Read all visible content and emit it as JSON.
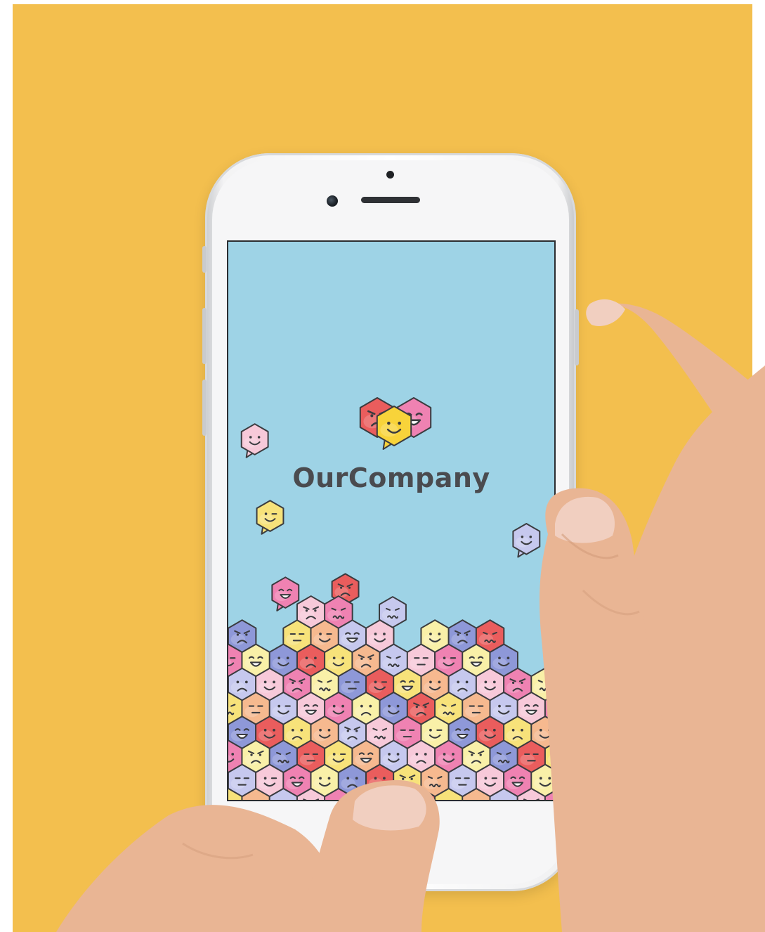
{
  "app": {
    "brand_name": "OurCompany",
    "logo_icon": "heart-of-speech-bubble-faces-logo"
  },
  "colors": {
    "backdrop": "#f3bf4e",
    "screen_background": "#9ed3e6",
    "phone_body": "#f6f6f7",
    "brand_text": "#4a4b4f",
    "emoji_yellow": "#f7e27a",
    "emoji_pink_light": "#f7c9d9",
    "emoji_pink": "#ef82b2",
    "emoji_red": "#ea5d5d",
    "emoji_peach": "#f6b98f",
    "emoji_lavender": "#c6c8ee",
    "emoji_blue": "#8e98d8",
    "emoji_cream": "#f9f0a8",
    "skin": "#e9b594"
  },
  "floating_emojis": [
    {
      "icon": "pink-smile-bubble-icon",
      "mood": "smile"
    },
    {
      "icon": "yellow-wink-bubble-icon",
      "mood": "wink"
    },
    {
      "icon": "pink-grin-bubble-icon",
      "mood": "grin"
    },
    {
      "icon": "red-angry-bubble-icon",
      "mood": "angry"
    },
    {
      "icon": "lavender-worried-bubble-icon",
      "mood": "worried"
    },
    {
      "icon": "grey-smile-bubble-icon",
      "mood": "smile"
    }
  ],
  "moods": [
    "smile",
    "grin",
    "wink",
    "neutral",
    "worried",
    "angry",
    "happy",
    "sad"
  ]
}
